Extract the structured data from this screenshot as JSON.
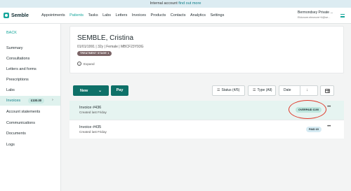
{
  "banner": {
    "text": "Internal account",
    "link": "find out more"
  },
  "brand": {
    "name": "Semble"
  },
  "nav": [
    "Appointments",
    "Patients",
    "Tasks",
    "Labs",
    "Letters",
    "Invoices",
    "Products",
    "Contacts",
    "Analytics",
    "Settings"
  ],
  "nav_active": "Patients",
  "account": {
    "name": "Bermondsey Private ...",
    "email": "Eldonore.eleonore+4@se..."
  },
  "sidebar": {
    "back": "BACK",
    "items": [
      "Summary",
      "Consultations",
      "Letters and forms",
      "Prescriptions",
      "Labs",
      "Invoices",
      "Account statements",
      "Communications",
      "Documents",
      "Logs"
    ],
    "active": "Invoices",
    "invoices_badge": "£100.00"
  },
  "patient": {
    "name": "SEMBLE, Cristina",
    "meta": "01/01/1991  |  32y  |  Female  |  MBCF23Y93G",
    "tag": "TREATMENT STAGE 1",
    "expand": "Expand"
  },
  "toolbar": {
    "new_label": "New",
    "pay_label": "Pay",
    "status_filter": "Status (4/5)",
    "type_filter": "Type (All)",
    "date_filter": "Date"
  },
  "invoices": [
    {
      "title": "Invoice #436",
      "created": "Created last Friday",
      "status": "OVERPAID £100"
    },
    {
      "title": "Invoice #435",
      "created": "Created last Friday",
      "status": "PAID £0"
    }
  ],
  "colors": {
    "accent": "#16a69b",
    "primary_button": "#0e7068",
    "annotation": "#e0392b"
  },
  "icons": [
    "menu-icon",
    "chevron-down-icon",
    "filter-icon",
    "sort-arrow-icon",
    "table-view-icon",
    "more-options-icon",
    "expand-icon",
    "chevron-right-icon"
  ]
}
